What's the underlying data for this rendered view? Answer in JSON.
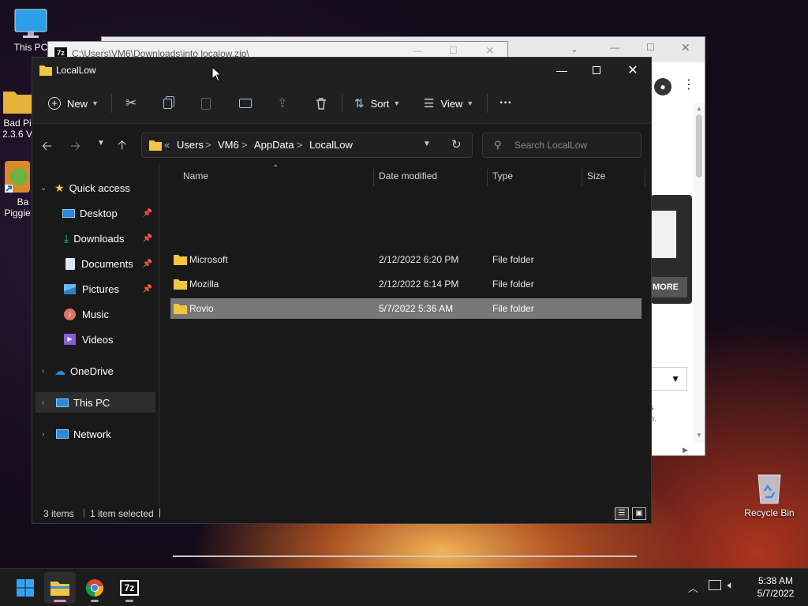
{
  "desktop": {
    "icons": [
      {
        "label": "This PC"
      },
      {
        "label": "Bad Pi"
      },
      {
        "label": "2.3.6 V"
      },
      {
        "label": "Ba"
      },
      {
        "label": "Piggie"
      },
      {
        "label": "Recycle Bin"
      }
    ]
  },
  "bg_window": {
    "title": "C:\\Users\\VM6\\Downloads\\into localow.zip\\",
    "zip_icon_text": "7z",
    "more_label": "MORE",
    "snippet1": "s",
    "snippet2": "n."
  },
  "explorer": {
    "title": "LocalLow",
    "toolbar": {
      "new_label": "New",
      "sort_label": "Sort",
      "view_label": "View",
      "more_label": "···"
    },
    "address": {
      "overflow": "«",
      "crumbs": [
        "Users",
        "VM6",
        "AppData",
        "LocalLow"
      ],
      "separator": ">"
    },
    "search_placeholder": "Search LocalLow",
    "nav": {
      "quick_access": "Quick access",
      "items": [
        {
          "label": "Desktop",
          "icon": "desktop-icon",
          "pinned": true
        },
        {
          "label": "Downloads",
          "icon": "downloads-icon",
          "pinned": true
        },
        {
          "label": "Documents",
          "icon": "documents-icon",
          "pinned": true
        },
        {
          "label": "Pictures",
          "icon": "pictures-icon",
          "pinned": true
        },
        {
          "label": "Music",
          "icon": "music-icon",
          "pinned": false
        },
        {
          "label": "Videos",
          "icon": "videos-icon",
          "pinned": false
        }
      ],
      "onedrive": "OneDrive",
      "thispc": "This PC",
      "network": "Network"
    },
    "columns": [
      "Name",
      "Date modified",
      "Type",
      "Size"
    ],
    "rows": [
      {
        "name": "Microsoft",
        "date": "2/12/2022 6:20 PM",
        "type": "File folder",
        "size": ""
      },
      {
        "name": "Mozilla",
        "date": "2/12/2022 6:14 PM",
        "type": "File folder",
        "size": ""
      },
      {
        "name": "Rovio",
        "date": "5/7/2022 5:36 AM",
        "type": "File folder",
        "size": ""
      }
    ],
    "status": {
      "items": "3 items",
      "selected": "1 item selected"
    }
  },
  "taskbar": {
    "apps": [
      "Start",
      "File Explorer",
      "Google Chrome",
      "7-Zip"
    ],
    "zip_text": "7z",
    "time": "5:38 AM",
    "date": "5/7/2022"
  },
  "colors": {
    "selection": "#777777",
    "folder": "#f4c542",
    "accent": "#2a8bdc"
  }
}
